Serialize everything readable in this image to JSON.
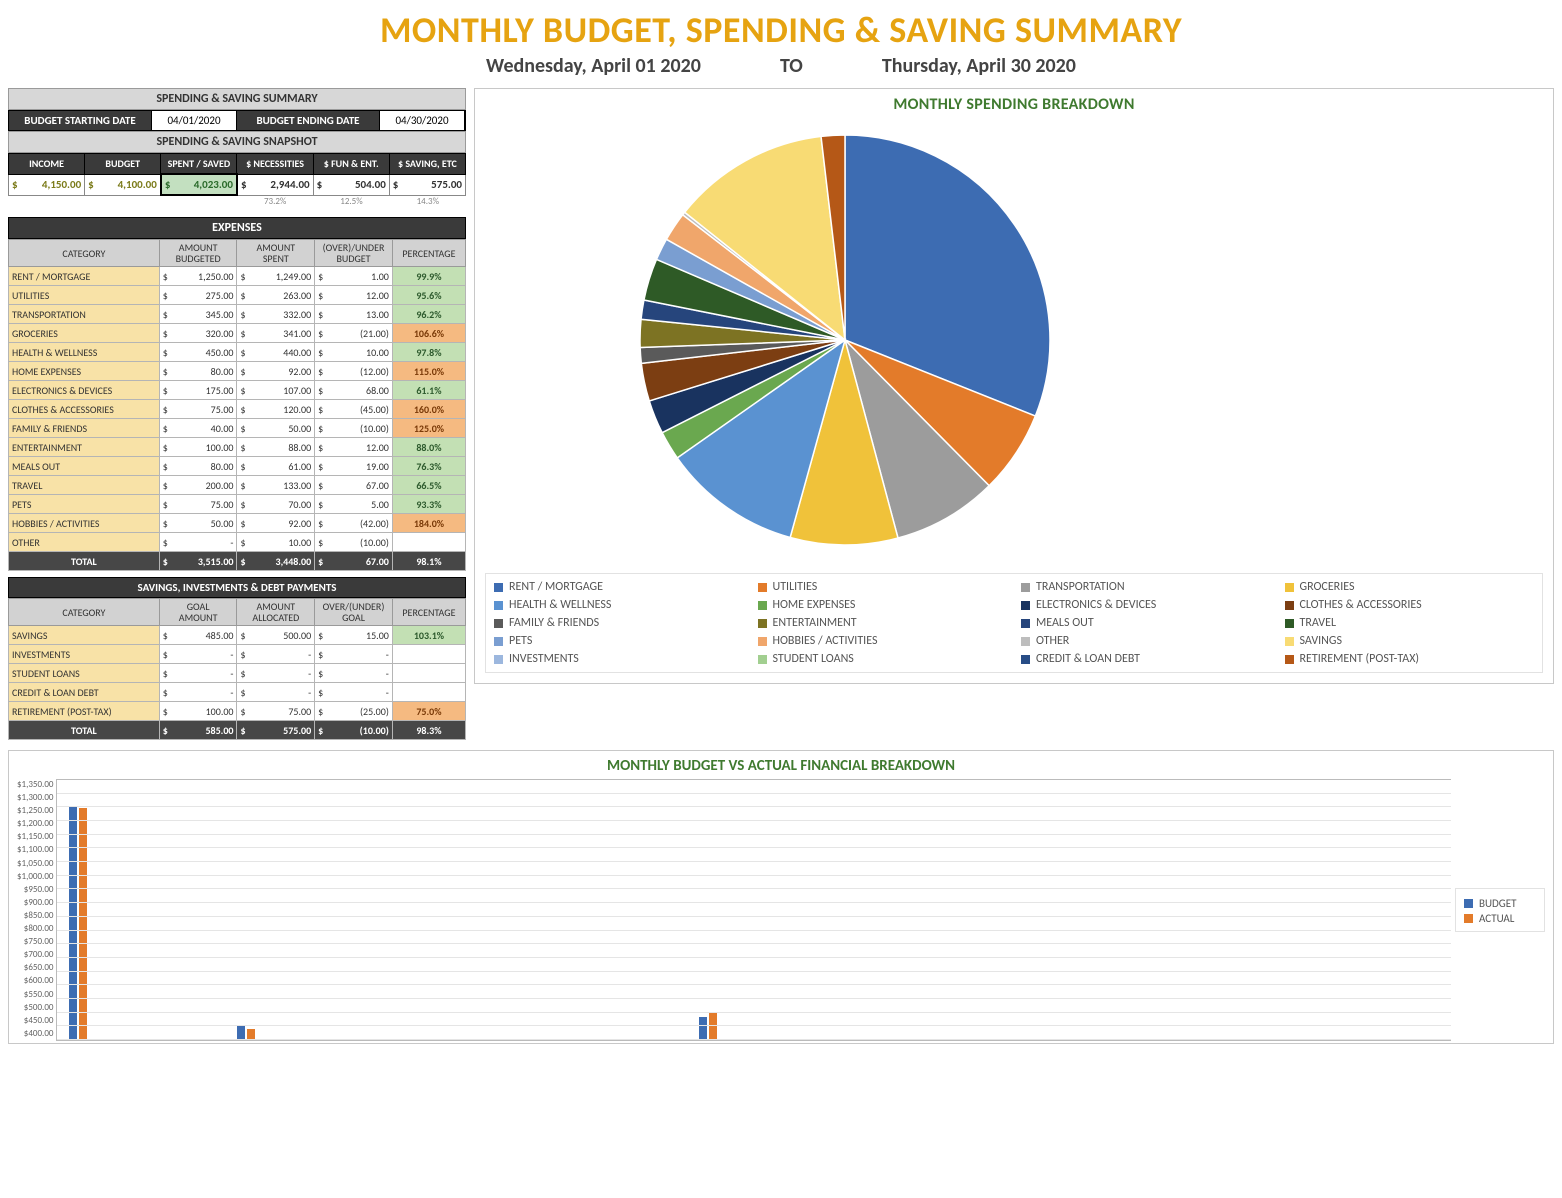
{
  "title": "MONTHLY BUDGET, SPENDING & SAVING SUMMARY",
  "dates": {
    "from": "Wednesday, April 01 2020",
    "to": "Thursday, April 30 2020",
    "sep": "TO"
  },
  "summaryBar": "SPENDING & SAVING SUMMARY",
  "budget_dates": {
    "start_label": "BUDGET STARTING DATE",
    "start": "04/01/2020",
    "end_label": "BUDGET ENDING DATE",
    "end": "04/30/2020"
  },
  "snapshotBar": "SPENDING & SAVING SNAPSHOT",
  "snapshot": {
    "headers": [
      "INCOME",
      "BUDGET",
      "SPENT / SAVED",
      "$ NECESSITIES",
      "$ FUN & ENT.",
      "$ SAVING, ETC"
    ],
    "values": [
      "4,150.00",
      "4,100.00",
      "4,023.00",
      "2,944.00",
      "504.00",
      "575.00"
    ],
    "pcts": [
      "",
      "",
      "",
      "73.2%",
      "12.5%",
      "14.3%"
    ]
  },
  "expensesBar": "EXPENSES",
  "expenses": {
    "headers": [
      "CATEGORY",
      "AMOUNT BUDGETED",
      "AMOUNT SPENT",
      "(OVER)/UNDER BUDGET",
      "PERCENTAGE"
    ],
    "rows": [
      {
        "cat": "RENT / MORTGAGE",
        "b": "1,250.00",
        "s": "1,249.00",
        "d": "1.00",
        "pct": "99.9%",
        "c": "g"
      },
      {
        "cat": "UTILITIES",
        "b": "275.00",
        "s": "263.00",
        "d": "12.00",
        "pct": "95.6%",
        "c": "g"
      },
      {
        "cat": "TRANSPORTATION",
        "b": "345.00",
        "s": "332.00",
        "d": "13.00",
        "pct": "96.2%",
        "c": "g"
      },
      {
        "cat": "GROCERIES",
        "b": "320.00",
        "s": "341.00",
        "d": "(21.00)",
        "pct": "106.6%",
        "c": "p"
      },
      {
        "cat": "HEALTH & WELLNESS",
        "b": "450.00",
        "s": "440.00",
        "d": "10.00",
        "pct": "97.8%",
        "c": "g"
      },
      {
        "cat": "HOME EXPENSES",
        "b": "80.00",
        "s": "92.00",
        "d": "(12.00)",
        "pct": "115.0%",
        "c": "p"
      },
      {
        "cat": "ELECTRONICS & DEVICES",
        "b": "175.00",
        "s": "107.00",
        "d": "68.00",
        "pct": "61.1%",
        "c": "g"
      },
      {
        "cat": "CLOTHES & ACCESSORIES",
        "b": "75.00",
        "s": "120.00",
        "d": "(45.00)",
        "pct": "160.0%",
        "c": "p"
      },
      {
        "cat": "FAMILY & FRIENDS",
        "b": "40.00",
        "s": "50.00",
        "d": "(10.00)",
        "pct": "125.0%",
        "c": "p"
      },
      {
        "cat": "ENTERTAINMENT",
        "b": "100.00",
        "s": "88.00",
        "d": "12.00",
        "pct": "88.0%",
        "c": "g"
      },
      {
        "cat": "MEALS OUT",
        "b": "80.00",
        "s": "61.00",
        "d": "19.00",
        "pct": "76.3%",
        "c": "g"
      },
      {
        "cat": "TRAVEL",
        "b": "200.00",
        "s": "133.00",
        "d": "67.00",
        "pct": "66.5%",
        "c": "g"
      },
      {
        "cat": "PETS",
        "b": "75.00",
        "s": "70.00",
        "d": "5.00",
        "pct": "93.3%",
        "c": "g"
      },
      {
        "cat": "HOBBIES / ACTIVITIES",
        "b": "50.00",
        "s": "92.00",
        "d": "(42.00)",
        "pct": "184.0%",
        "c": "p"
      },
      {
        "cat": "OTHER",
        "b": "-",
        "s": "10.00",
        "d": "(10.00)",
        "pct": "",
        "c": ""
      }
    ],
    "total": {
      "label": "TOTAL",
      "b": "3,515.00",
      "s": "3,448.00",
      "d": "67.00",
      "pct": "98.1%"
    }
  },
  "savingsBar": "SAVINGS, INVESTMENTS & DEBT PAYMENTS",
  "savings": {
    "headers": [
      "CATEGORY",
      "GOAL AMOUNT",
      "AMOUNT ALLOCATED",
      "OVER/(UNDER) GOAL",
      "PERCENTAGE"
    ],
    "rows": [
      {
        "cat": "SAVINGS",
        "b": "485.00",
        "s": "500.00",
        "d": "15.00",
        "pct": "103.1%",
        "c": "g"
      },
      {
        "cat": "INVESTMENTS",
        "b": "-",
        "s": "-",
        "d": "-",
        "pct": "",
        "c": ""
      },
      {
        "cat": "STUDENT LOANS",
        "b": "-",
        "s": "-",
        "d": "-",
        "pct": "",
        "c": ""
      },
      {
        "cat": "CREDIT & LOAN DEBT",
        "b": "-",
        "s": "-",
        "d": "-",
        "pct": "",
        "c": ""
      },
      {
        "cat": "RETIREMENT (POST-TAX)",
        "b": "100.00",
        "s": "75.00",
        "d": "(25.00)",
        "pct": "75.0%",
        "c": "p"
      }
    ],
    "total": {
      "label": "TOTAL",
      "b": "585.00",
      "s": "575.00",
      "d": "(10.00)",
      "pct": "98.3%"
    }
  },
  "pieTitle": "MONTHLY SPENDING BREAKDOWN",
  "barTitle": "MONTHLY BUDGET VS ACTUAL FINANCIAL BREAKDOWN",
  "barLegend": {
    "a": "BUDGET",
    "b": "ACTUAL"
  },
  "chart_data": [
    {
      "type": "pie",
      "title": "MONTHLY SPENDING BREAKDOWN",
      "series": [
        {
          "name": "RENT / MORTGAGE",
          "value": 1249,
          "color": "#3d6cb2"
        },
        {
          "name": "UTILITIES",
          "value": 263,
          "color": "#e37b2a"
        },
        {
          "name": "TRANSPORTATION",
          "value": 332,
          "color": "#9c9c9c"
        },
        {
          "name": "GROCERIES",
          "value": 341,
          "color": "#f0c23a"
        },
        {
          "name": "HEALTH & WELLNESS",
          "value": 440,
          "color": "#5a92d1"
        },
        {
          "name": "HOME EXPENSES",
          "value": 92,
          "color": "#6aa84f"
        },
        {
          "name": "ELECTRONICS & DEVICES",
          "value": 107,
          "color": "#19335f"
        },
        {
          "name": "CLOTHES & ACCESSORIES",
          "value": 120,
          "color": "#7c3e12"
        },
        {
          "name": "FAMILY & FRIENDS",
          "value": 50,
          "color": "#5a5a5a"
        },
        {
          "name": "ENTERTAINMENT",
          "value": 88,
          "color": "#7d7323"
        },
        {
          "name": "MEALS OUT",
          "value": 61,
          "color": "#26457c"
        },
        {
          "name": "TRAVEL",
          "value": 133,
          "color": "#2e5a26"
        },
        {
          "name": "PETS",
          "value": 70,
          "color": "#7a9ed1"
        },
        {
          "name": "HOBBIES / ACTIVITIES",
          "value": 92,
          "color": "#f0a66b"
        },
        {
          "name": "OTHER",
          "value": 10,
          "color": "#bdbdbd"
        },
        {
          "name": "SAVINGS",
          "value": 500,
          "color": "#f8db74"
        },
        {
          "name": "INVESTMENTS",
          "value": 0,
          "color": "#9cb7de"
        },
        {
          "name": "STUDENT LOANS",
          "value": 0,
          "color": "#a2cf90"
        },
        {
          "name": "CREDIT & LOAN DEBT",
          "value": 0,
          "color": "#284d86"
        },
        {
          "name": "RETIREMENT (POST-TAX)",
          "value": 75,
          "color": "#b55817"
        }
      ]
    },
    {
      "type": "bar",
      "title": "MONTHLY BUDGET VS ACTUAL FINANCIAL BREAKDOWN",
      "ylabel": "",
      "ylim": [
        0,
        1350
      ],
      "yticks": [
        "$1,350.00",
        "$1,300.00",
        "$1,250.00",
        "$1,200.00",
        "$1,150.00",
        "$1,100.00",
        "$1,050.00",
        "$1,000.00",
        "$950.00",
        "$900.00",
        "$850.00",
        "$800.00",
        "$750.00",
        "$700.00",
        "$650.00",
        "$600.00",
        "$550.00",
        "$500.00",
        "$450.00",
        "$400.00"
      ],
      "categories": [
        "RENT / MORTGAGE",
        "UTILITIES",
        "TRANSPORTATION",
        "GROCERIES",
        "HEALTH & WELLNESS",
        "HOME EXPENSES",
        "ELECTRONICS & DEVICES",
        "CLOTHES & ACCESSORIES",
        "FAMILY & FRIENDS",
        "ENTERTAINMENT",
        "MEALS OUT",
        "TRAVEL",
        "PETS",
        "HOBBIES / ACTIVITIES",
        "OTHER",
        "SAVINGS",
        "INVESTMENTS",
        "STUDENT LOANS",
        "CREDIT & LOAN DEBT",
        "RETIREMENT (POST-TAX)"
      ],
      "series": [
        {
          "name": "BUDGET",
          "color": "#3d6cb2",
          "values": [
            1250,
            275,
            345,
            320,
            450,
            80,
            175,
            75,
            40,
            100,
            80,
            200,
            75,
            50,
            0,
            485,
            0,
            0,
            0,
            100
          ]
        },
        {
          "name": "ACTUAL",
          "color": "#e37b2a",
          "values": [
            1249,
            263,
            332,
            341,
            440,
            92,
            107,
            120,
            50,
            88,
            61,
            133,
            70,
            92,
            10,
            500,
            0,
            0,
            0,
            75
          ]
        }
      ]
    }
  ]
}
